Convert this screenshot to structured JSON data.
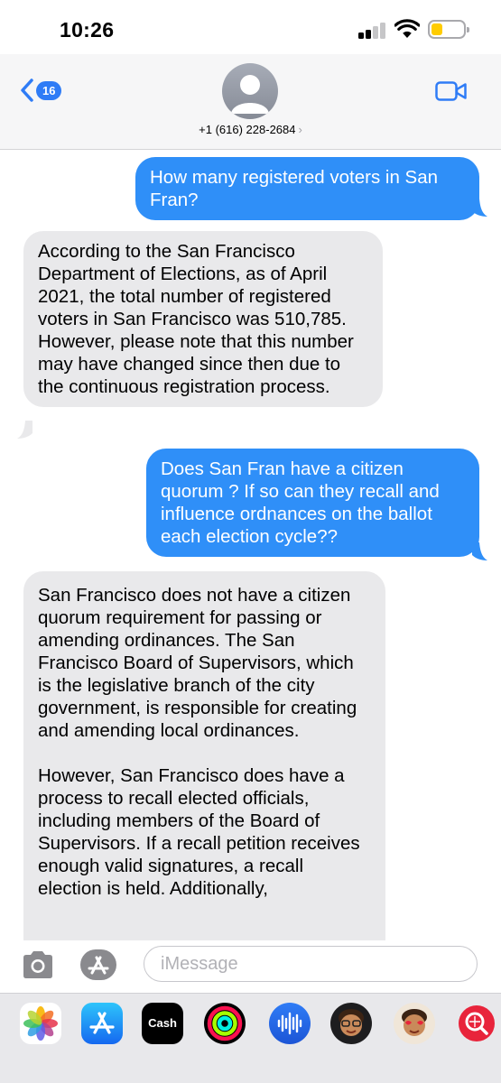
{
  "status": {
    "time": "10:26"
  },
  "header": {
    "back_count": "16",
    "contact_number": "+1 (616) 228-2684",
    "contact_chevron": "›"
  },
  "messages": [
    {
      "from": "me",
      "text": "How many registered voters in San Fran?"
    },
    {
      "from": "them",
      "text": "According to the San Francisco Department of Elections, as of April 2021, the total number of registered voters in San Francisco was 510,785. However, please note that this number may have changed since then due to the continuous registration process."
    },
    {
      "from": "me",
      "text": "Does San Fran have a citizen quorum ? If so can they recall and influence ordnances on the ballot each election cycle??"
    },
    {
      "from": "them",
      "paragraph1": "San Francisco does not have a citizen quorum requirement for passing or amending ordinances. The San Francisco Board of Supervisors, which is the legislative branch of the city government, is responsible for creating and amending local ordinances.",
      "paragraph2": "However, San Francisco does have a process to recall elected officials, including members of the Board of Supervisors. If a recall petition receives enough valid signatures, a recall election is held. Additionally,"
    }
  ],
  "input": {
    "placeholder": "iMessage"
  },
  "app_strip": {
    "cash_label": "Cash",
    "apple_symbol": "",
    "icons": [
      "photos-icon",
      "app-store-icon",
      "apple-cash-icon",
      "activity-icon",
      "audio-message-icon",
      "memoji-icon",
      "memoji-stickers-icon",
      "web-search-icon"
    ]
  },
  "colors": {
    "outgoing_bubble": "#2f8ff8",
    "incoming_bubble": "#e9e9eb",
    "accent": "#2f7cf6",
    "battery_fill": "#ffcc00"
  }
}
